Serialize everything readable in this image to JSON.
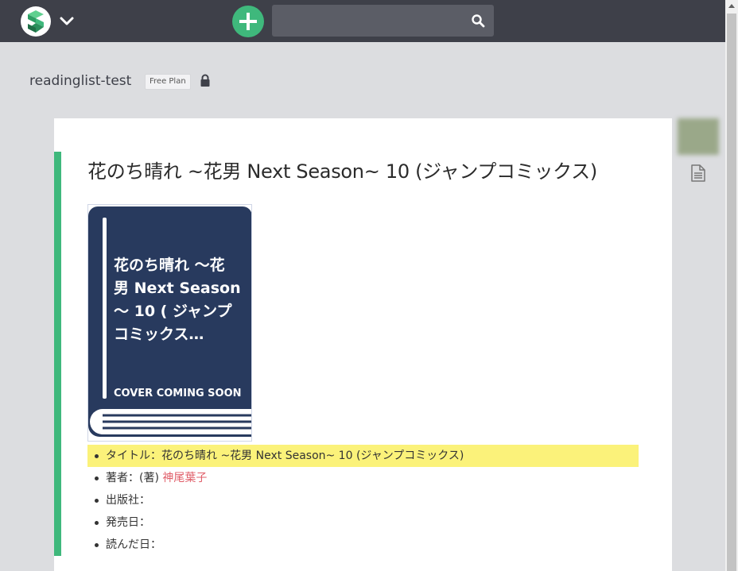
{
  "workspace": {
    "name": "readinglist-test",
    "plan": "Free Plan"
  },
  "search": {
    "value": "",
    "placeholder": ""
  },
  "icons": {
    "logo": "scrapbox-logo-icon",
    "chevron": "chevron-down-icon",
    "add": "plus-icon",
    "search": "search-icon",
    "lock": "lock-icon",
    "page": "document-icon"
  },
  "colors": {
    "accent": "#3fb87c",
    "topbar": "#3e4049",
    "highlight": "#fbf27a",
    "link": "#e05d68",
    "cover": "#283a5e"
  },
  "page": {
    "title": "花のち晴れ ~花男 Next Season~ 10 (ジャンプコミックス)",
    "cover": {
      "title_lines": [
        "花のち晴れ ～花",
        "男 Next Season",
        "～ 10 ( ジャンプ",
        "コミックス…"
      ],
      "caption": "COVER COMING SOON"
    },
    "info": {
      "title_label": "タイトル：",
      "title_value": "花のち晴れ ~花男 Next Season~ 10 (ジャンプコミックス)",
      "author_label": "著者：(著) ",
      "author_value": "神尾葉子",
      "publisher_label": "出版社：",
      "release_label": "発売日：",
      "read_label": "読んだ日："
    }
  }
}
